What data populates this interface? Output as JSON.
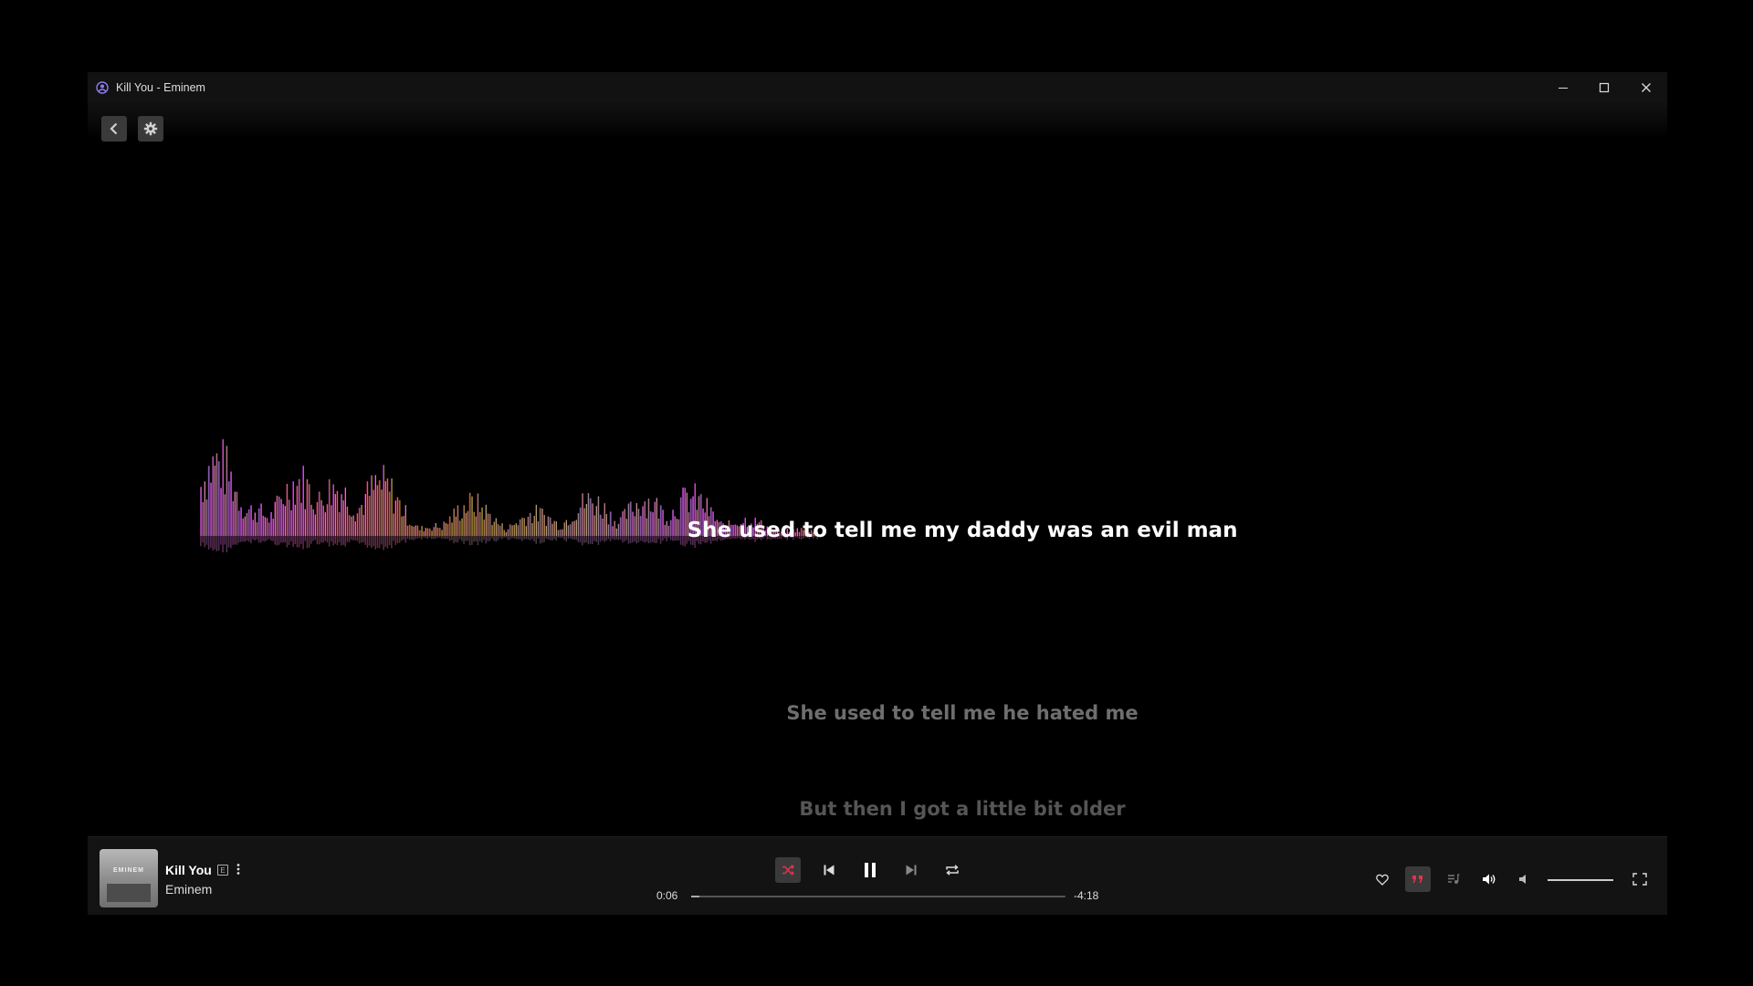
{
  "window": {
    "title": "Kill You - Eminem",
    "accent_color": "#e0344a"
  },
  "toolbar": {
    "back_icon": "chevron-left-icon",
    "settings_icon": "gear-icon"
  },
  "lyrics": {
    "current": "She used to tell me my daddy was an evil man",
    "next": [
      "She used to tell me he hated me",
      "But then I got a little bit older"
    ]
  },
  "visualizer": {
    "colors": [
      "#ff1a1a",
      "#b3168f",
      "#3a1ee6",
      "#5a5ad0",
      "#c8c060",
      "#f2e61a",
      "#c08060"
    ]
  },
  "now_playing": {
    "title": "Kill You",
    "explicit_badge": "E",
    "artist": "Eminem",
    "album_art_label": "EMINEM"
  },
  "playback": {
    "elapsed": "0:06",
    "remaining": "-4:18",
    "progress_fraction": 0.023,
    "shuffle_on": true,
    "state": "playing"
  },
  "volume": {
    "level_fraction": 1.0
  }
}
